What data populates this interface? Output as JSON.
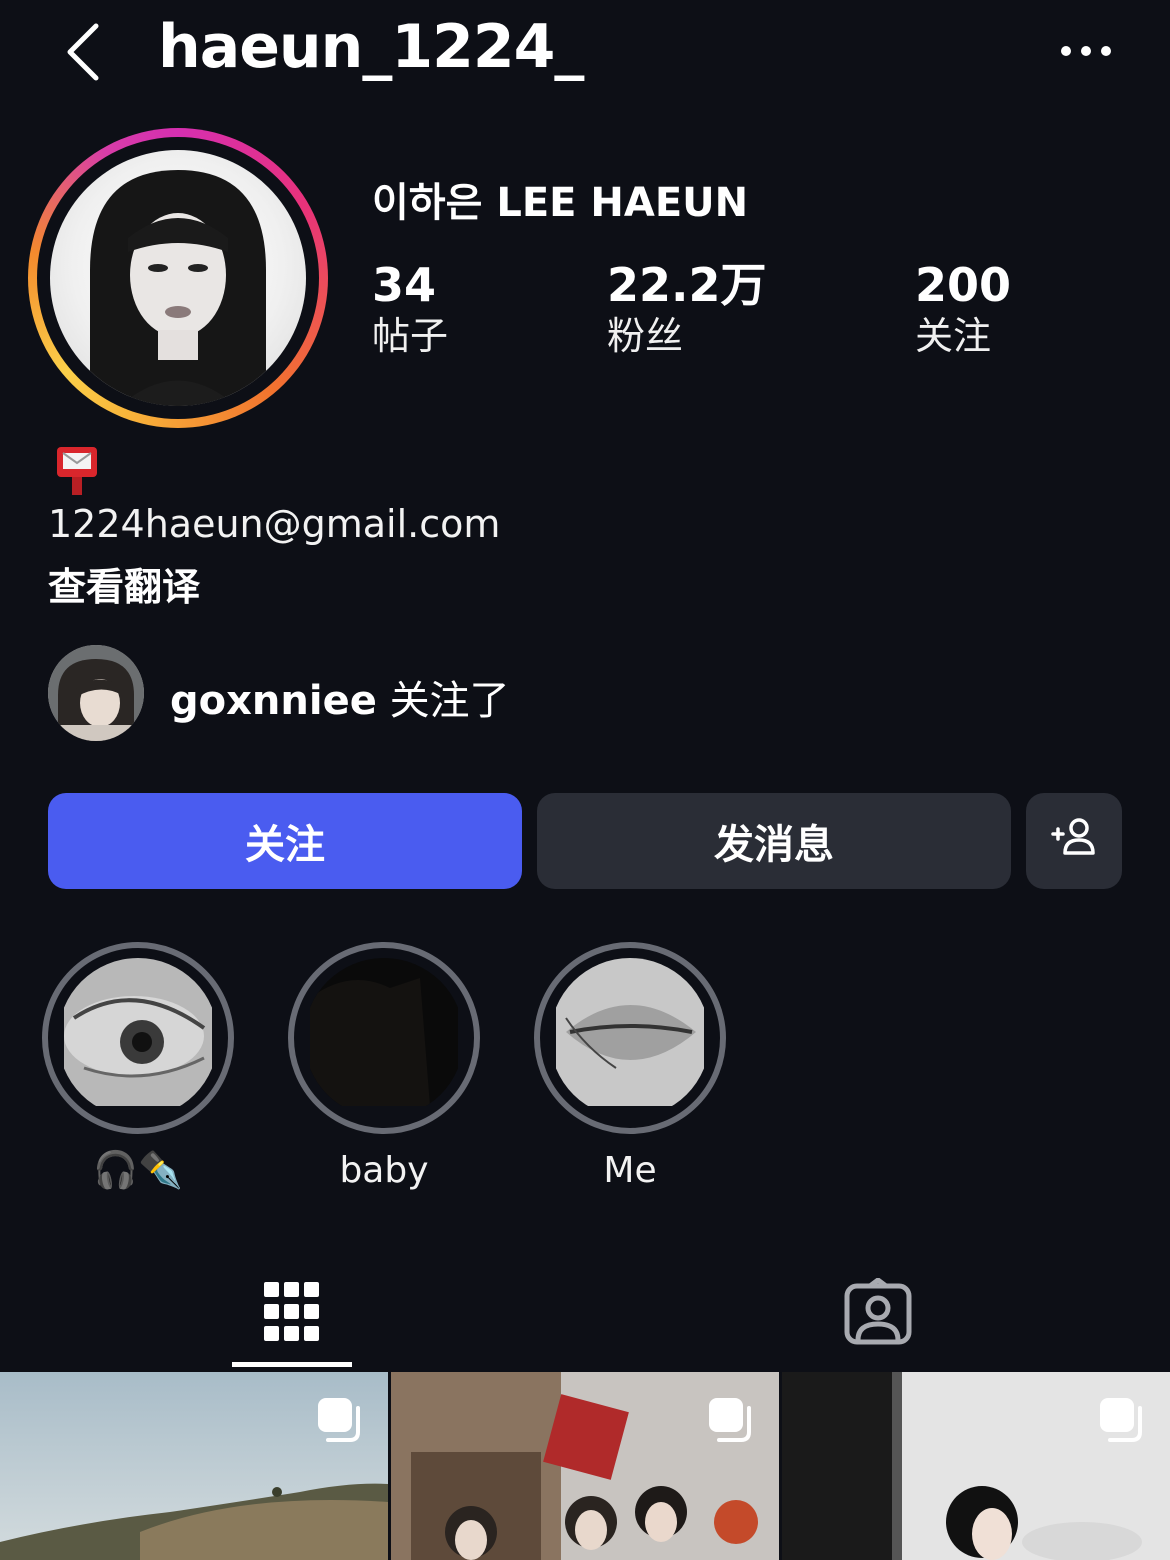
{
  "header": {
    "username": "haeun_1224_"
  },
  "profile": {
    "display_name": "이하은 LEE HAEUN",
    "stats": [
      {
        "value": "34",
        "label": "帖子"
      },
      {
        "value": "22.2万",
        "label": "粉丝"
      },
      {
        "value": "200",
        "label": "关注"
      }
    ],
    "bio_email": "1224haeun@gmail.com",
    "translate_label": "查看翻译"
  },
  "mutual": {
    "username": "goxnniee",
    "suffix": "关注了"
  },
  "actions": {
    "follow_label": "关注",
    "message_label": "发消息"
  },
  "highlights": [
    {
      "label": "🎧✒️",
      "icon": "headphones-and-pen"
    },
    {
      "label": "baby"
    },
    {
      "label": "Me"
    }
  ],
  "colors": {
    "background": "#0d0f16",
    "follow_button": "#4a5cf0",
    "secondary_button": "#2a2d36"
  }
}
